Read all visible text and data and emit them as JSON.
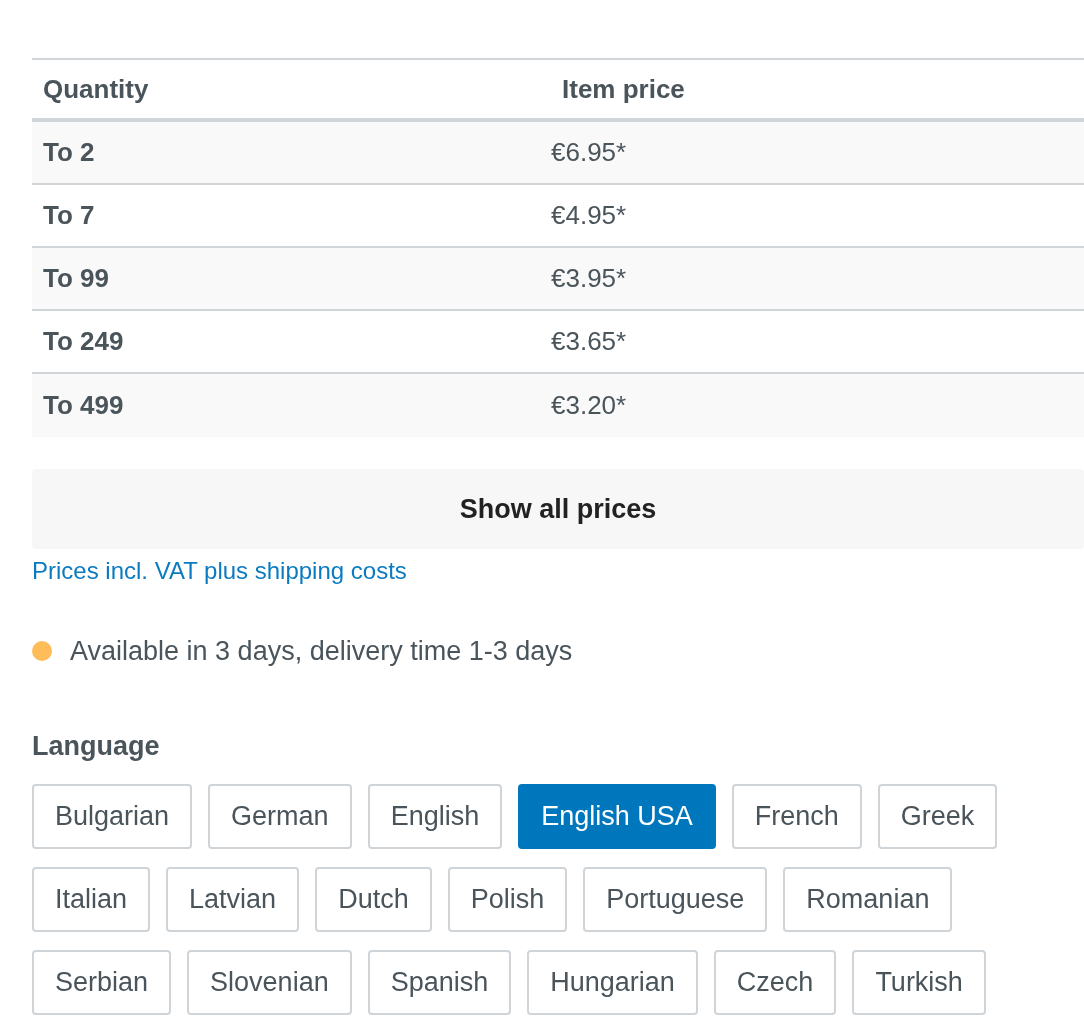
{
  "price_table": {
    "columns": [
      "Quantity",
      "Item price"
    ],
    "rows": [
      {
        "quantity": "To 2",
        "price": "€6.95*"
      },
      {
        "quantity": "To 7",
        "price": "€4.95*"
      },
      {
        "quantity": "To 99",
        "price": "€3.95*"
      },
      {
        "quantity": "To 249",
        "price": "€3.65*"
      },
      {
        "quantity": "To 499",
        "price": "€3.20*"
      }
    ]
  },
  "show_all_button": "Show all prices",
  "vat_link": "Prices incl. VAT plus shipping costs",
  "availability": {
    "text": "Available in 3 days, delivery time 1-3 days",
    "color": "#ffbd5a"
  },
  "language": {
    "label": "Language",
    "options": [
      {
        "label": "Bulgarian",
        "selected": false
      },
      {
        "label": "German",
        "selected": false
      },
      {
        "label": "English",
        "selected": false
      },
      {
        "label": "English USA",
        "selected": true
      },
      {
        "label": "French",
        "selected": false
      },
      {
        "label": "Greek",
        "selected": false
      },
      {
        "label": "Italian",
        "selected": false
      },
      {
        "label": "Latvian",
        "selected": false
      },
      {
        "label": "Dutch",
        "selected": false
      },
      {
        "label": "Polish",
        "selected": false
      },
      {
        "label": "Portuguese",
        "selected": false
      },
      {
        "label": "Romanian",
        "selected": false
      },
      {
        "label": "Serbian",
        "selected": false
      },
      {
        "label": "Slovenian",
        "selected": false
      },
      {
        "label": "Spanish",
        "selected": false
      },
      {
        "label": "Hungarian",
        "selected": false
      },
      {
        "label": "Czech",
        "selected": false
      },
      {
        "label": "Turkish",
        "selected": false
      }
    ]
  }
}
